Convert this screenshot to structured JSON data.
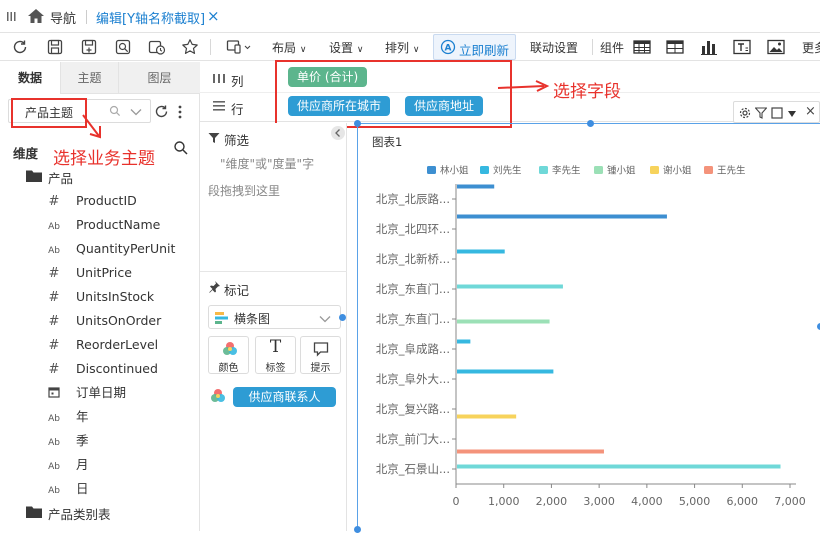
{
  "topbar": {
    "menu_icon": "menu-icon",
    "home_label": "导航",
    "tab_title": "编辑[Y轴名称截取]",
    "close_label": "×"
  },
  "toolbar": {
    "layout_label": "布局",
    "settings_label": "设置",
    "arrange_label": "排列",
    "refresh_label": "立即刷新",
    "linkage_label": "联动设置",
    "component_label": "组件",
    "more_label": "更多"
  },
  "left_panel": {
    "tabs": [
      "数据",
      "主题",
      "图层"
    ],
    "subject_value": "产品主题",
    "dimension_label": "维度",
    "groups": [
      {
        "label": "产品"
      },
      {
        "label": "产品类别表"
      }
    ],
    "fields": [
      {
        "icon": "#",
        "label": "ProductID"
      },
      {
        "icon": "Ab",
        "label": "ProductName"
      },
      {
        "icon": "Ab",
        "label": "QuantityPerUnit"
      },
      {
        "icon": "#",
        "label": "UnitPrice"
      },
      {
        "icon": "#",
        "label": "UnitsInStock"
      },
      {
        "icon": "#",
        "label": "UnitsOnOrder"
      },
      {
        "icon": "#",
        "label": "ReorderLevel"
      },
      {
        "icon": "#",
        "label": "Discontinued"
      },
      {
        "icon": "cal",
        "label": "订单日期"
      },
      {
        "icon": "Ab",
        "label": "年"
      },
      {
        "icon": "Ab",
        "label": "季"
      },
      {
        "icon": "Ab",
        "label": "月"
      },
      {
        "icon": "Ab",
        "label": "日"
      }
    ]
  },
  "shelves": {
    "column_label": "列",
    "row_label": "行",
    "column_chip": "单价 (合计)",
    "row_chips": [
      "供应商所在城市",
      "供应商地址"
    ]
  },
  "mid_panel": {
    "filter_label": "筛选",
    "filter_hint_line1": "\"维度\"或\"度量\"字",
    "filter_hint_line2": "段拖拽到这里",
    "marks_label": "标记",
    "chart_type": "横条图",
    "mark_buttons": [
      "颜色",
      "标签",
      "提示"
    ],
    "color_chip": "供应商联系人"
  },
  "annotations": {
    "select_field": "选择字段",
    "select_subject": "选择业务主题"
  },
  "chart_title": "图表1",
  "chart_data": {
    "type": "bar",
    "orientation": "horizontal",
    "categories": [
      "北京_北辰路...",
      "北京_北四环...",
      "北京_北新桥...",
      "北京_东直门...",
      "北京_东直门...",
      "北京_阜成路...",
      "北京_阜外大...",
      "北京_复兴路...",
      "北京_前门大...",
      "北京_石景山..."
    ],
    "legend": [
      "林小姐",
      "刘先生",
      "李先生",
      "锺小姐",
      "谢小姐",
      "王先生"
    ],
    "legend_colors": [
      "#3d8fd1",
      "#36b8e0",
      "#6fd8d8",
      "#9be0b6",
      "#f7d35c",
      "#f4937b"
    ],
    "bars": [
      {
        "category": 0,
        "series": 0,
        "value": 780
      },
      {
        "category": 1,
        "series": 0,
        "value": 4400
      },
      {
        "category": 2,
        "series": 1,
        "value": 1000
      },
      {
        "category": 3,
        "series": 2,
        "value": 2220
      },
      {
        "category": 4,
        "series": 3,
        "value": 1940
      },
      {
        "category": 5,
        "series": 1,
        "value": 280
      },
      {
        "category": 6,
        "series": 1,
        "value": 2020
      },
      {
        "category": 7,
        "series": 4,
        "value": 1240
      },
      {
        "category": 8,
        "series": 5,
        "value": 3080
      },
      {
        "category": 9,
        "series": 2,
        "value": 6780
      }
    ],
    "x_ticks": [
      "0",
      "1,000",
      "2,000",
      "3,000",
      "4,000",
      "5,000",
      "6,000",
      "7,000"
    ],
    "xlim": [
      0,
      7000
    ]
  }
}
